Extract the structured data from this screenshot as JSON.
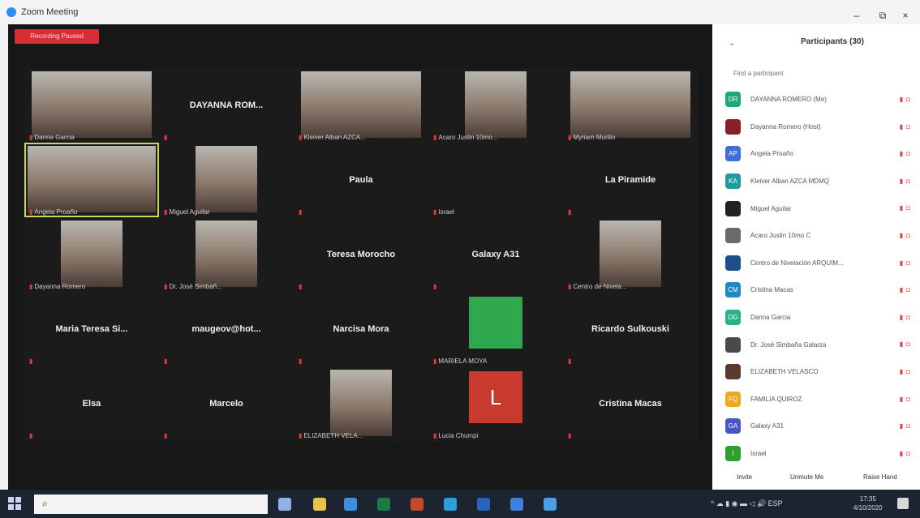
{
  "window": {
    "title": "Zoom Meeting",
    "minimize": "–",
    "maximize": "⧉",
    "close": "×"
  },
  "stage": {
    "recording_badge": "Recording Paused",
    "tiles": [
      {
        "label": "Danna Garcia",
        "kind": "video"
      },
      {
        "center_name": "DAYANNA ROM...",
        "kind": "name"
      },
      {
        "label": "Kleiver Alban AZCA...",
        "kind": "video"
      },
      {
        "label": "Acaro Justin 10mo...",
        "kind": "video"
      },
      {
        "label": "Myriam Murillo",
        "kind": "video"
      },
      {
        "label": "Angela Proaño",
        "kind": "video",
        "active": true
      },
      {
        "label": "Miguel Aguilar",
        "kind": "video"
      },
      {
        "center_name": "Paula",
        "kind": "name"
      },
      {
        "label": "Israel",
        "kind": "name"
      },
      {
        "center_name": "La Piramide",
        "kind": "name"
      },
      {
        "label": "Dayanna Romero",
        "kind": "video"
      },
      {
        "label": "Dr. José Simbañ...",
        "kind": "video"
      },
      {
        "center_name": "Teresa Morocho",
        "kind": "name"
      },
      {
        "center_name": "Galaxy A31",
        "kind": "name"
      },
      {
        "label": "Centro de Nivela...",
        "kind": "video"
      },
      {
        "center_name": "Maria Teresa Si...",
        "kind": "name"
      },
      {
        "center_name": "maugeov@hot...",
        "kind": "name"
      },
      {
        "center_name": "Narcisa Mora",
        "kind": "name"
      },
      {
        "label": "MARIELA MOYA",
        "kind": "color",
        "color": "#2fa84f"
      },
      {
        "center_name": "Ricardo Sulkouski",
        "kind": "name"
      },
      {
        "center_name": "Elsa",
        "kind": "name"
      },
      {
        "center_name": "Marcelo",
        "kind": "name"
      },
      {
        "label": "ELIZABETH VELA...",
        "kind": "video"
      },
      {
        "label": "Lucia Chumpi",
        "kind": "color",
        "color": "#c8392e",
        "letter": "L"
      },
      {
        "center_name": "Cristina Macas",
        "kind": "name"
      }
    ]
  },
  "panel": {
    "title": "Participants (30)",
    "collapse": "⌄",
    "search_placeholder": "Find a participant",
    "participants": [
      {
        "initials": "DR",
        "color": "#1fa67a",
        "name": "DAYANNA ROMERO (Me)"
      },
      {
        "initials": "",
        "color": "#8a1f2a",
        "name": "Dayanna Romero (Host)"
      },
      {
        "initials": "AP",
        "color": "#3f6fd0",
        "name": "Angela Proaño"
      },
      {
        "initials": "KA",
        "color": "#1f9aa0",
        "name": "Kleiver Alban AZCA MDMQ"
      },
      {
        "initials": "",
        "color": "#222222",
        "name": "Miguel Aguilar"
      },
      {
        "initials": "",
        "color": "#6b6b6b",
        "name": "Acaro Justin 10mo C"
      },
      {
        "initials": "",
        "color": "#1f4f8a",
        "name": "Centro de Nivelación ARQUIM..."
      },
      {
        "initials": "CM",
        "color": "#1f8ac0",
        "name": "Cristina Macas"
      },
      {
        "initials": "DG",
        "color": "#2ab08a",
        "name": "Danna Garcia"
      },
      {
        "initials": "",
        "color": "#4a4a4a",
        "name": "Dr. José Simbaña Galarza"
      },
      {
        "initials": "",
        "color": "#5a3a2a",
        "name": "ELIZABETH VELASCO"
      },
      {
        "initials": "FQ",
        "color": "#f0a820",
        "name": "FAMILIA QUIROZ"
      },
      {
        "initials": "GA",
        "color": "#4a55c0",
        "name": "Galaxy A31"
      },
      {
        "initials": "I",
        "color": "#2ca02c",
        "name": "Israel"
      }
    ],
    "footer": {
      "invite": "Invite",
      "unmute": "Unmute Me",
      "raise": "Raise Hand"
    }
  },
  "taskbar": {
    "search_icon": "⌕",
    "tray_text": "^ ☁ ▮ ◉ ▬ ◁ 🔊 ESP",
    "time": "17:35",
    "date": "4/10/2020",
    "apps": [
      "#8fb0e8",
      "#e8c34a",
      "#3f8fe0",
      "#1e7a44",
      "#c04a2a",
      "#2ca0d8",
      "#2a62c0",
      "#3f7fe0",
      "#4aa0e0"
    ]
  }
}
